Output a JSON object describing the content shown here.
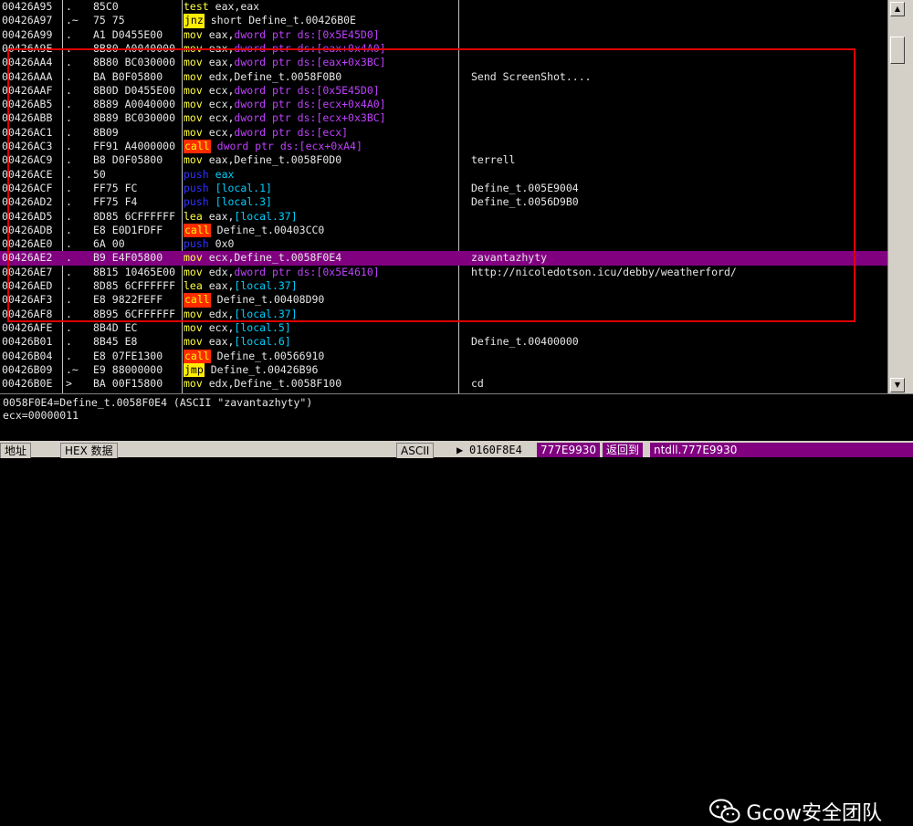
{
  "rows": [
    {
      "addr": "00426A95",
      "mark": ".",
      "hex": "85C0",
      "ins": "test",
      "ops": [
        [
          "eax,eax",
          "def"
        ]
      ],
      "cmt": ""
    },
    {
      "addr": "00426A97",
      "mark": ".~",
      "hex": "75 75",
      "ins": "jnz",
      "ops": [
        [
          "short Define_t.00426B0E",
          "def"
        ]
      ],
      "cmt": ""
    },
    {
      "addr": "00426A99",
      "mark": ".",
      "hex": "A1 D0455E00",
      "ins": "mov",
      "ops": [
        [
          "eax,",
          "def"
        ],
        [
          "dword ptr ds:[0x5E45D0]",
          "mem"
        ]
      ],
      "cmt": ""
    },
    {
      "addr": "00426A9E",
      "mark": ".",
      "hex": "8B80 A0040000",
      "ins": "mov",
      "ops": [
        [
          "eax,",
          "def"
        ],
        [
          "dword ptr ds:[eax+0x4A0]",
          "mem"
        ]
      ],
      "cmt": ""
    },
    {
      "addr": "00426AA4",
      "mark": ".",
      "hex": "8B80 BC030000",
      "ins": "mov",
      "ops": [
        [
          "eax,",
          "def"
        ],
        [
          "dword ptr ds:[eax+0x3BC]",
          "mem"
        ]
      ],
      "cmt": ""
    },
    {
      "addr": "00426AAA",
      "mark": ".",
      "hex": "BA B0F05800",
      "ins": "mov",
      "ops": [
        [
          "edx,Define_t.0058F0B0",
          "def"
        ]
      ],
      "cmt": "Send ScreenShot...."
    },
    {
      "addr": "00426AAF",
      "mark": ".",
      "hex": "8B0D D0455E00",
      "ins": "mov",
      "ops": [
        [
          "ecx,",
          "def"
        ],
        [
          "dword ptr ds:[0x5E45D0]",
          "mem"
        ]
      ],
      "cmt": ""
    },
    {
      "addr": "00426AB5",
      "mark": ".",
      "hex": "8B89 A0040000",
      "ins": "mov",
      "ops": [
        [
          "ecx,",
          "def"
        ],
        [
          "dword ptr ds:[ecx+0x4A0]",
          "mem"
        ]
      ],
      "cmt": ""
    },
    {
      "addr": "00426ABB",
      "mark": ".",
      "hex": "8B89 BC030000",
      "ins": "mov",
      "ops": [
        [
          "ecx,",
          "def"
        ],
        [
          "dword ptr ds:[ecx+0x3BC]",
          "mem"
        ]
      ],
      "cmt": ""
    },
    {
      "addr": "00426AC1",
      "mark": ".",
      "hex": "8B09",
      "ins": "mov",
      "ops": [
        [
          "ecx,",
          "def"
        ],
        [
          "dword ptr ds:[ecx]",
          "mem"
        ]
      ],
      "cmt": ""
    },
    {
      "addr": "00426AC3",
      "mark": ".",
      "hex": "FF91 A4000000",
      "ins": "call",
      "ops": [
        [
          "dword ptr ds:[ecx+0xA4]",
          "mem"
        ]
      ],
      "cmt": ""
    },
    {
      "addr": "00426AC9",
      "mark": ".",
      "hex": "B8 D0F05800",
      "ins": "mov",
      "ops": [
        [
          "eax,Define_t.0058F0D0",
          "def"
        ]
      ],
      "cmt": "terrell"
    },
    {
      "addr": "00426ACE",
      "mark": ".",
      "hex": "50",
      "ins": "push",
      "ops": [
        [
          "eax",
          "loc"
        ]
      ],
      "cmt": ""
    },
    {
      "addr": "00426ACF",
      "mark": ".",
      "hex": "FF75 FC",
      "ins": "push",
      "ops": [
        [
          "[local.1]",
          "loc"
        ]
      ],
      "cmt": "Define_t.005E9004"
    },
    {
      "addr": "00426AD2",
      "mark": ".",
      "hex": "FF75 F4",
      "ins": "push",
      "ops": [
        [
          "[local.3]",
          "loc"
        ]
      ],
      "cmt": "Define_t.0056D9B0"
    },
    {
      "addr": "00426AD5",
      "mark": ".",
      "hex": "8D85 6CFFFFFF",
      "ins": "lea",
      "ops": [
        [
          "eax,",
          "def"
        ],
        [
          "[local.37]",
          "loc"
        ]
      ],
      "cmt": ""
    },
    {
      "addr": "00426ADB",
      "mark": ".",
      "hex": "E8 E0D1FDFF",
      "ins": "call",
      "ops": [
        [
          "Define_t.00403CC0",
          "def"
        ]
      ],
      "cmt": ""
    },
    {
      "addr": "00426AE0",
      "mark": ".",
      "hex": "6A 00",
      "ins": "push",
      "ops": [
        [
          "0x0",
          "imm"
        ]
      ],
      "cmt": ""
    },
    {
      "addr": "00426AE2",
      "mark": ".",
      "hex": "B9 E4F05800",
      "ins": "mov",
      "ops": [
        [
          "ecx,Define_t.0058F0E4",
          "def"
        ]
      ],
      "cmt": "zavantazhyty",
      "hl": true
    },
    {
      "addr": "00426AE7",
      "mark": ".",
      "hex": "8B15 10465E00",
      "ins": "mov",
      "ops": [
        [
          "edx,",
          "def"
        ],
        [
          "dword ptr ds:[0x5E4610]",
          "mem"
        ]
      ],
      "cmt": "http://nicoledotson.icu/debby/weatherford/"
    },
    {
      "addr": "00426AED",
      "mark": ".",
      "hex": "8D85 6CFFFFFF",
      "ins": "lea",
      "ops": [
        [
          "eax,",
          "def"
        ],
        [
          "[local.37]",
          "loc"
        ]
      ],
      "cmt": ""
    },
    {
      "addr": "00426AF3",
      "mark": ".",
      "hex": "E8 9822FEFF",
      "ins": "call",
      "ops": [
        [
          "Define_t.00408D90",
          "def"
        ]
      ],
      "cmt": ""
    },
    {
      "addr": "00426AF8",
      "mark": ".",
      "hex": "8B95 6CFFFFFF",
      "ins": "mov",
      "ops": [
        [
          "edx,",
          "def"
        ],
        [
          "[local.37]",
          "loc"
        ]
      ],
      "cmt": ""
    },
    {
      "addr": "00426AFE",
      "mark": ".",
      "hex": "8B4D EC",
      "ins": "mov",
      "ops": [
        [
          "ecx,",
          "def"
        ],
        [
          "[local.5]",
          "loc"
        ]
      ],
      "cmt": ""
    },
    {
      "addr": "00426B01",
      "mark": ".",
      "hex": "8B45 E8",
      "ins": "mov",
      "ops": [
        [
          "eax,",
          "def"
        ],
        [
          "[local.6]",
          "loc"
        ]
      ],
      "cmt": "Define_t.00400000"
    },
    {
      "addr": "00426B04",
      "mark": ".",
      "hex": "E8 07FE1300",
      "ins": "call",
      "ops": [
        [
          "Define_t.00566910",
          "def"
        ]
      ],
      "cmt": ""
    },
    {
      "addr": "00426B09",
      "mark": ".~",
      "hex": "E9 88000000",
      "ins": "jmp",
      "ops": [
        [
          "Define_t.00426B96",
          "def"
        ]
      ],
      "cmt": ""
    },
    {
      "addr": "00426B0E",
      "mark": ">",
      "hex": "BA 00F15800",
      "ins": "mov",
      "ops": [
        [
          "edx,Define_t.0058F100",
          "def"
        ]
      ],
      "cmt": "cd"
    }
  ],
  "info": {
    "line1": "0058F0E4=Define_t.0058F0E4 (ASCII \"zavantazhyty\")",
    "line2": "ecx=00000011"
  },
  "watermark": {
    "text": "Gcow安全团队",
    "icon": "wechat-icon"
  },
  "statusbar": {
    "addr_label": "地址",
    "hex_label": "HEX 数据",
    "ascii_label": "ASCII",
    "stack_addr": "0160F8E4",
    "stack_val": "777E9930",
    "ret_label": "返回到",
    "ret_target": "ntdll.777E9930"
  },
  "colors": {
    "highlight": "#800080",
    "red_box": "#e00000",
    "call_bg": "#ff2a00",
    "jump_bg": "#ffee00",
    "mem_operand": "#c040ff"
  }
}
